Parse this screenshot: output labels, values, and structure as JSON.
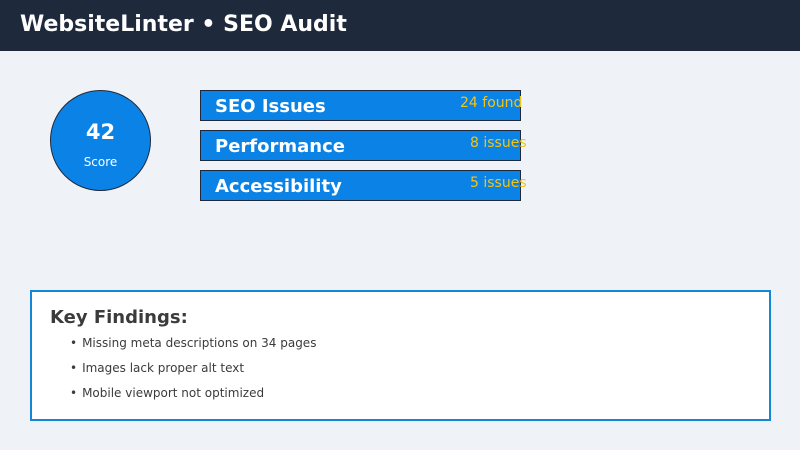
{
  "header": {
    "title": "WebsiteLinter • SEO Audit"
  },
  "score": {
    "value": "42",
    "label": "Score"
  },
  "metrics": [
    {
      "title": "SEO Issues",
      "value": "24 found"
    },
    {
      "title": "Performance",
      "value": "8 issues"
    },
    {
      "title": "Accessibility",
      "value": "5 issues"
    }
  ],
  "findings": {
    "title": "Key Findings:",
    "bullet": "•",
    "items": [
      "Missing meta descriptions on 34 pages",
      "Images lack proper alt text",
      "Mobile viewport not optimized"
    ]
  },
  "colors": {
    "header_bg": "#1e293b",
    "page_bg": "#eff3f8",
    "accent_blue": "#0b83e6",
    "value_yellow": "#f3c316",
    "text_dark": "#3b3b3b"
  }
}
